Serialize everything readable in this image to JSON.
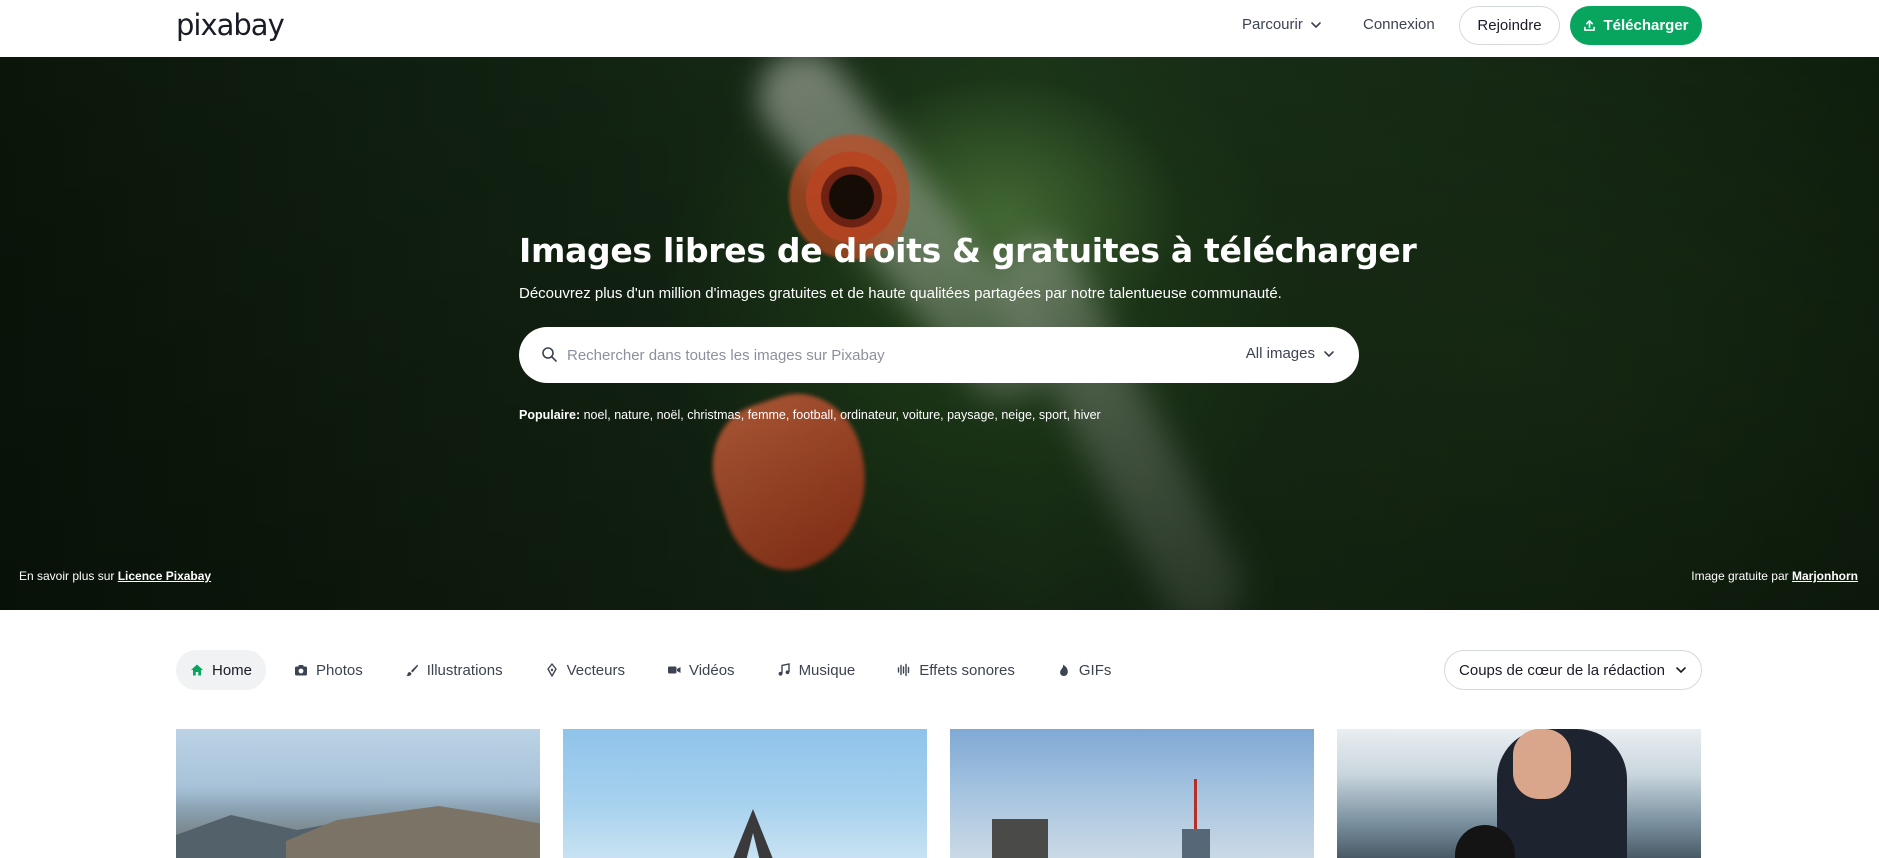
{
  "header": {
    "logo": "pixabay",
    "browse_label": "Parcourir",
    "login_label": "Connexion",
    "join_label": "Rejoindre",
    "upload_label": "Télécharger"
  },
  "hero": {
    "title": "Images libres de droits & gratuites à télécharger",
    "subtitle": "Découvrez plus d'un million d'images gratuites et de haute qualitées partagées par notre talentueuse communauté.",
    "search": {
      "placeholder": "Rechercher dans toutes les images sur Pixabay",
      "value": "",
      "filter_label": "All images"
    },
    "popular": {
      "label": "Populaire:",
      "tags": [
        "noel",
        "nature",
        "noël",
        "christmas",
        "femme",
        "football",
        "ordinateur",
        "voiture",
        "paysage",
        "neige",
        "sport",
        "hiver"
      ]
    },
    "license_prefix": "En savoir plus sur",
    "license_link": "Licence Pixabay",
    "credit_prefix": "Image gratuite par",
    "credit_author": "Marjonhorn"
  },
  "categories": {
    "tabs": [
      {
        "label": "Home",
        "icon": "home-icon",
        "active": true
      },
      {
        "label": "Photos",
        "icon": "camera-icon",
        "active": false
      },
      {
        "label": "Illustrations",
        "icon": "brush-icon",
        "active": false
      },
      {
        "label": "Vecteurs",
        "icon": "pen-nib-icon",
        "active": false
      },
      {
        "label": "Vidéos",
        "icon": "video-icon",
        "active": false
      },
      {
        "label": "Musique",
        "icon": "music-note-icon",
        "active": false
      },
      {
        "label": "Effets sonores",
        "icon": "sound-wave-icon",
        "active": false
      },
      {
        "label": "GIFs",
        "icon": "flame-icon",
        "active": false
      }
    ],
    "sort_label": "Coups de cœur de la rédaction"
  },
  "colors": {
    "brand_green": "#07a55e",
    "text_dark": "#191b26",
    "text_muted": "#3c4451",
    "active_tab_bg": "#f1f2f3"
  }
}
